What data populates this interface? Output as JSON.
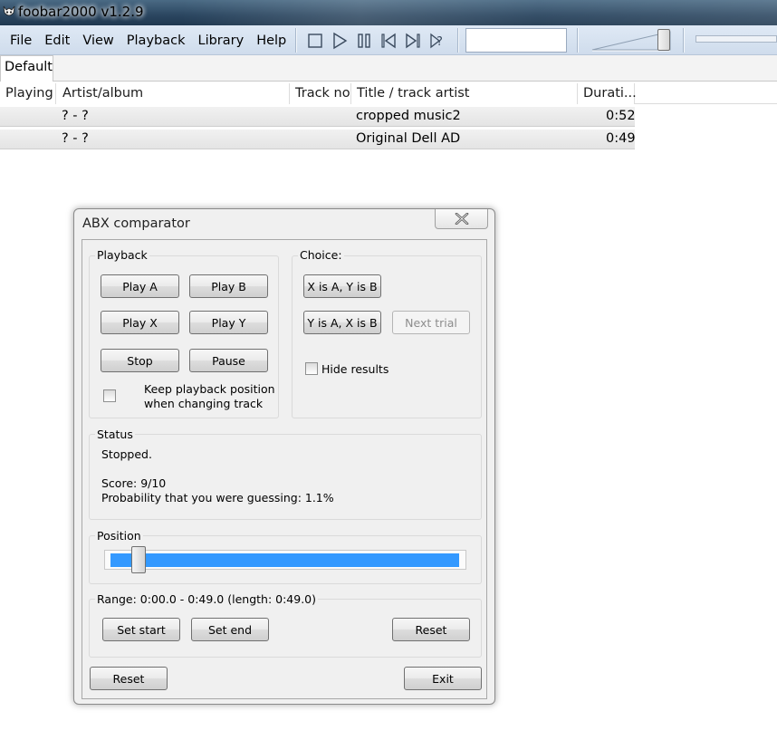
{
  "window": {
    "title": "foobar2000 v1.2.9"
  },
  "menu": [
    "File",
    "Edit",
    "View",
    "Playback",
    "Library",
    "Help"
  ],
  "toolbar": {
    "icons": [
      "stop-icon",
      "play-icon",
      "pause-icon",
      "previous-icon",
      "next-icon",
      "random-icon"
    ]
  },
  "tabs": [
    {
      "label": "Default",
      "active": true
    }
  ],
  "playlist": {
    "columns": [
      "Playing",
      "Artist/album",
      "Track no",
      "Title / track artist",
      "Durati..."
    ],
    "rows": [
      {
        "playing": "",
        "artist_album": "? - ?",
        "track_no": "",
        "title": "cropped music2",
        "duration": "0:52"
      },
      {
        "playing": "",
        "artist_album": "? - ?",
        "track_no": "",
        "title": "Original Dell AD",
        "duration": "0:49"
      }
    ]
  },
  "abx": {
    "title": "ABX comparator",
    "playback": {
      "label": "Playback",
      "play_a": "Play A",
      "play_b": "Play B",
      "play_x": "Play X",
      "play_y": "Play Y",
      "stop": "Stop",
      "pause": "Pause",
      "keep_position": "Keep playback position when changing track"
    },
    "choice": {
      "label": "Choice:",
      "x_is_a": "X is A, Y is B",
      "y_is_a": "Y is A, X is B",
      "next_trial": "Next trial",
      "hide_results": "Hide results"
    },
    "status": {
      "label": "Status",
      "state": "Stopped.",
      "score": "Score: 9/10",
      "probability": "Probability that you were guessing: 1.1%"
    },
    "position": {
      "label": "Position",
      "value_fraction": 0.08
    },
    "range": {
      "label": "Range: 0:00.0 - 0:49.0 (length: 0:49.0)",
      "set_start": "Set start",
      "set_end": "Set end",
      "reset": "Reset"
    },
    "reset": "Reset",
    "exit": "Exit"
  },
  "colors": {
    "accent": "#3399ff",
    "titlebar": "#2b4660"
  }
}
